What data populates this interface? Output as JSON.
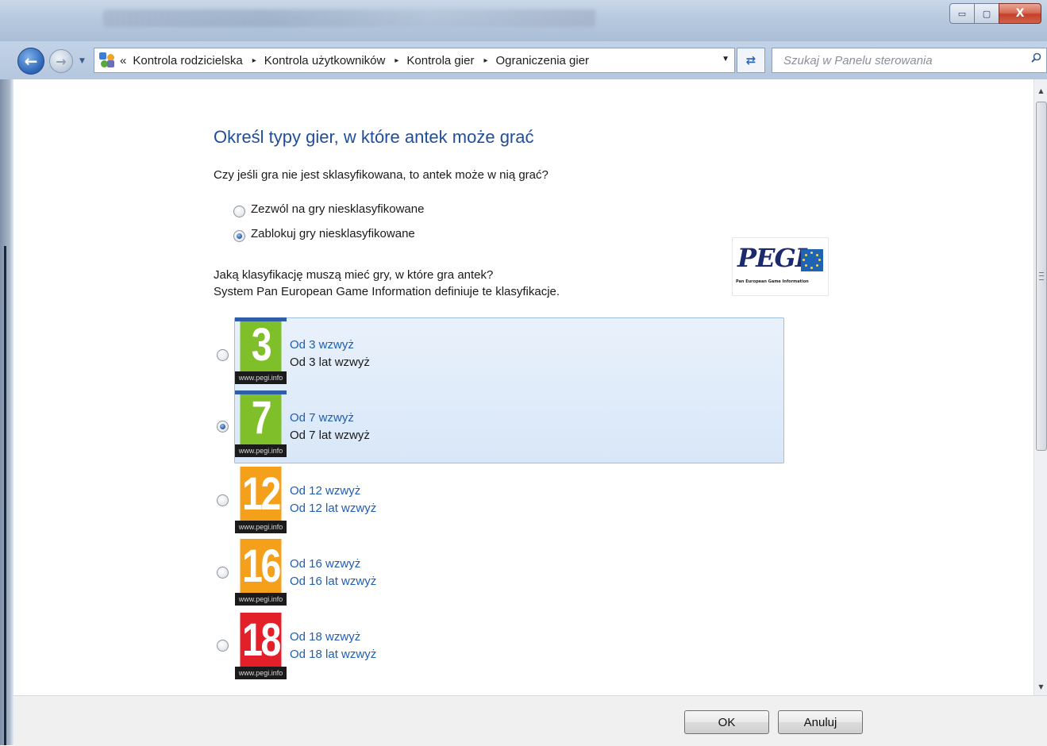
{
  "window": {
    "close_glyph": "X",
    "minimize_glyph": "▭",
    "maximize_glyph": "▢"
  },
  "address": {
    "overflow_glyph": "«",
    "breadcrumbs": [
      "Kontrola rodzicielska",
      "Kontrola użytkowników",
      "Kontrola gier",
      "Ograniczenia gier"
    ],
    "separator_glyph": "▸"
  },
  "search": {
    "placeholder": "Szukaj w Panelu sterowania"
  },
  "main": {
    "title": "Określ typy gier, w które antek może grać",
    "unrated_question": "Czy jeśli gra nie jest sklasyfikowana, to antek może w nią grać?",
    "unrated_options": [
      {
        "label": "Zezwól na gry niesklasyfikowane",
        "checked": false
      },
      {
        "label": "Zablokuj gry niesklasyfikowane",
        "checked": true
      }
    ],
    "rating_question_line1": "Jaką klasyfikację muszą mieć gry, w które gra antek?",
    "rating_question_line2": "System Pan European Game Information definiuje te klasyfikacje.",
    "logo": {
      "word": "PEGI",
      "subtitle": "Pan European Game Information"
    },
    "ratings": [
      {
        "number": "3",
        "title": "Od 3 wzwyż",
        "desc": "Od 3 lat wzwyż",
        "strip": "www.pegi.info",
        "color": "#7fbf2a",
        "allowed": true,
        "checked": false
      },
      {
        "number": "7",
        "title": "Od 7 wzwyż",
        "desc": "Od 7 lat wzwyż",
        "strip": "www.pegi.info",
        "color": "#7fbf2a",
        "allowed": true,
        "checked": true
      },
      {
        "number": "12",
        "title": "Od 12 wzwyż",
        "desc": "Od 12 lat wzwyż",
        "strip": "www.pegi.info",
        "color": "#f4a01a",
        "allowed": false,
        "checked": false
      },
      {
        "number": "16",
        "title": "Od 16 wzwyż",
        "desc": "Od 16 lat wzwyż",
        "strip": "www.pegi.info",
        "color": "#f4a01a",
        "allowed": false,
        "checked": false
      },
      {
        "number": "18",
        "title": "Od 18 wzwyż",
        "desc": "Od 18 lat wzwyż",
        "strip": "www.pegi.info",
        "color": "#e3202a",
        "allowed": false,
        "checked": false
      }
    ]
  },
  "footer": {
    "ok_label": "OK",
    "cancel_label": "Anuluj"
  },
  "colors": {
    "title_blue": "#1f4f9a",
    "link_blue": "#1f5db1",
    "selection_fill": "#dde9f8",
    "selection_border": "#9cc0e9"
  }
}
